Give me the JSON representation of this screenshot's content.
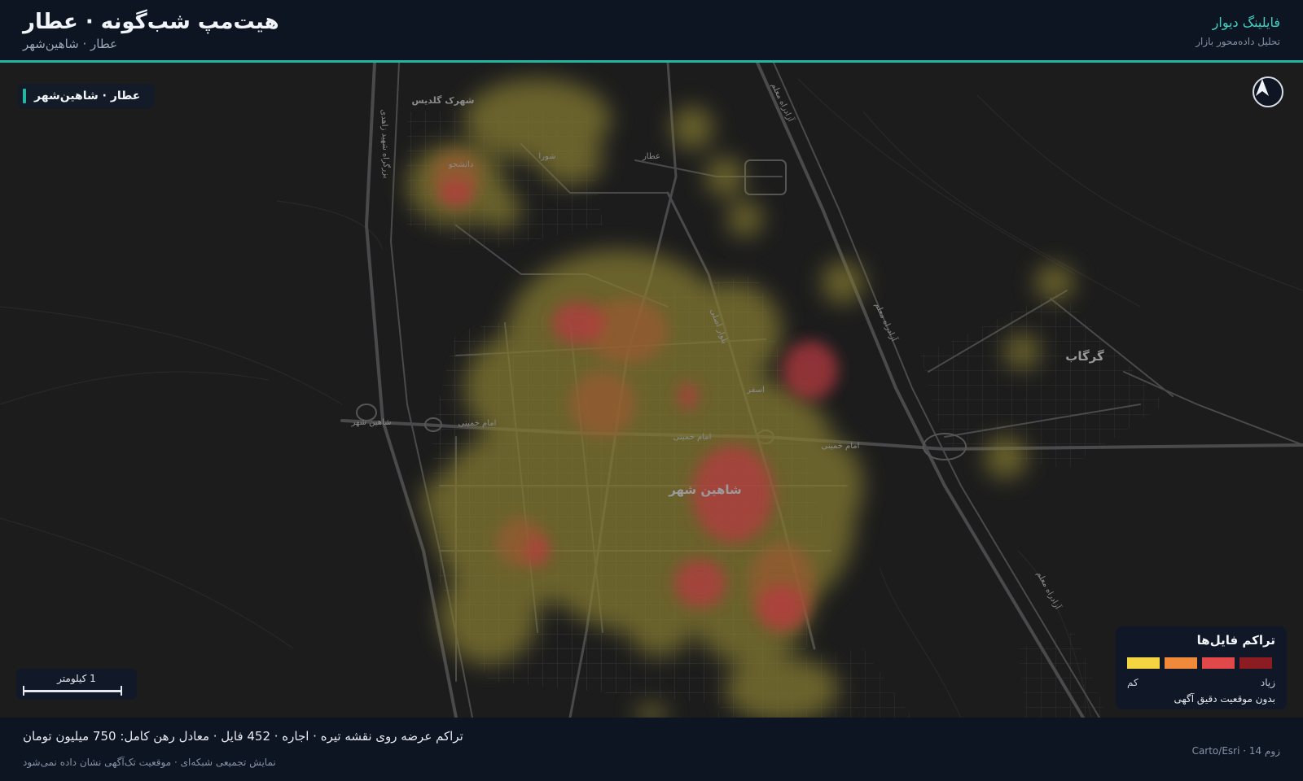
{
  "header": {
    "title": "هیت‌مپ شب‌گونه · عطار",
    "subtitle": "عطار · شاهین‌شهر",
    "brand": "فایلینگ دیوار",
    "brand_tagline": "تحلیل داده‌محور بازار"
  },
  "map": {
    "location_chip": "عطار · شاهین‌شهر",
    "north_arrow_icon": "north-arrow-icon",
    "scale_label": "1 کیلومتر",
    "place_labels": {
      "city": "شاهین شهر",
      "gorgab": "گرگاب",
      "golestan": "شهرک گلدیس",
      "daneshju": "دانشجو",
      "shora": "شورا",
      "emam_khomeini_1": "امام خمینی",
      "emam_khomeini_2": "امام خمینی",
      "emam_khomeini_3": "امام خمینی",
      "shahinshahr_road": "شاهین شهر",
      "asfar": "اسفر",
      "atar": "عطار",
      "bolvar_asli": "بلوار اصلی",
      "azadrah_1": "آزادراه معلم",
      "azadrah_2": "آزادراه معلم",
      "azadrah_3": "آزادراه معلم",
      "bozorgrah": "بزرگراه شهید زاهدی"
    }
  },
  "legend": {
    "title": "تراکم فایل‌ها",
    "high_label": "زیاد",
    "low_label": "کم",
    "note": "بدون موقعیت دقیق آگهی",
    "colors": [
      "#f5d442",
      "#f08a3a",
      "#e0484a",
      "#8b1d22"
    ]
  },
  "footer": {
    "summary": "تراکم عرضه روی نقشه تیره · اجاره · 452 فایل · معادل رهن کامل: 750 میلیون تومان",
    "note": "نمایش تجمیعی شبکه‌ای · موقعیت تک‌آگهی نشان داده نمی‌شود",
    "zoom_attribution": "زوم 14 · Carto/Esri"
  }
}
